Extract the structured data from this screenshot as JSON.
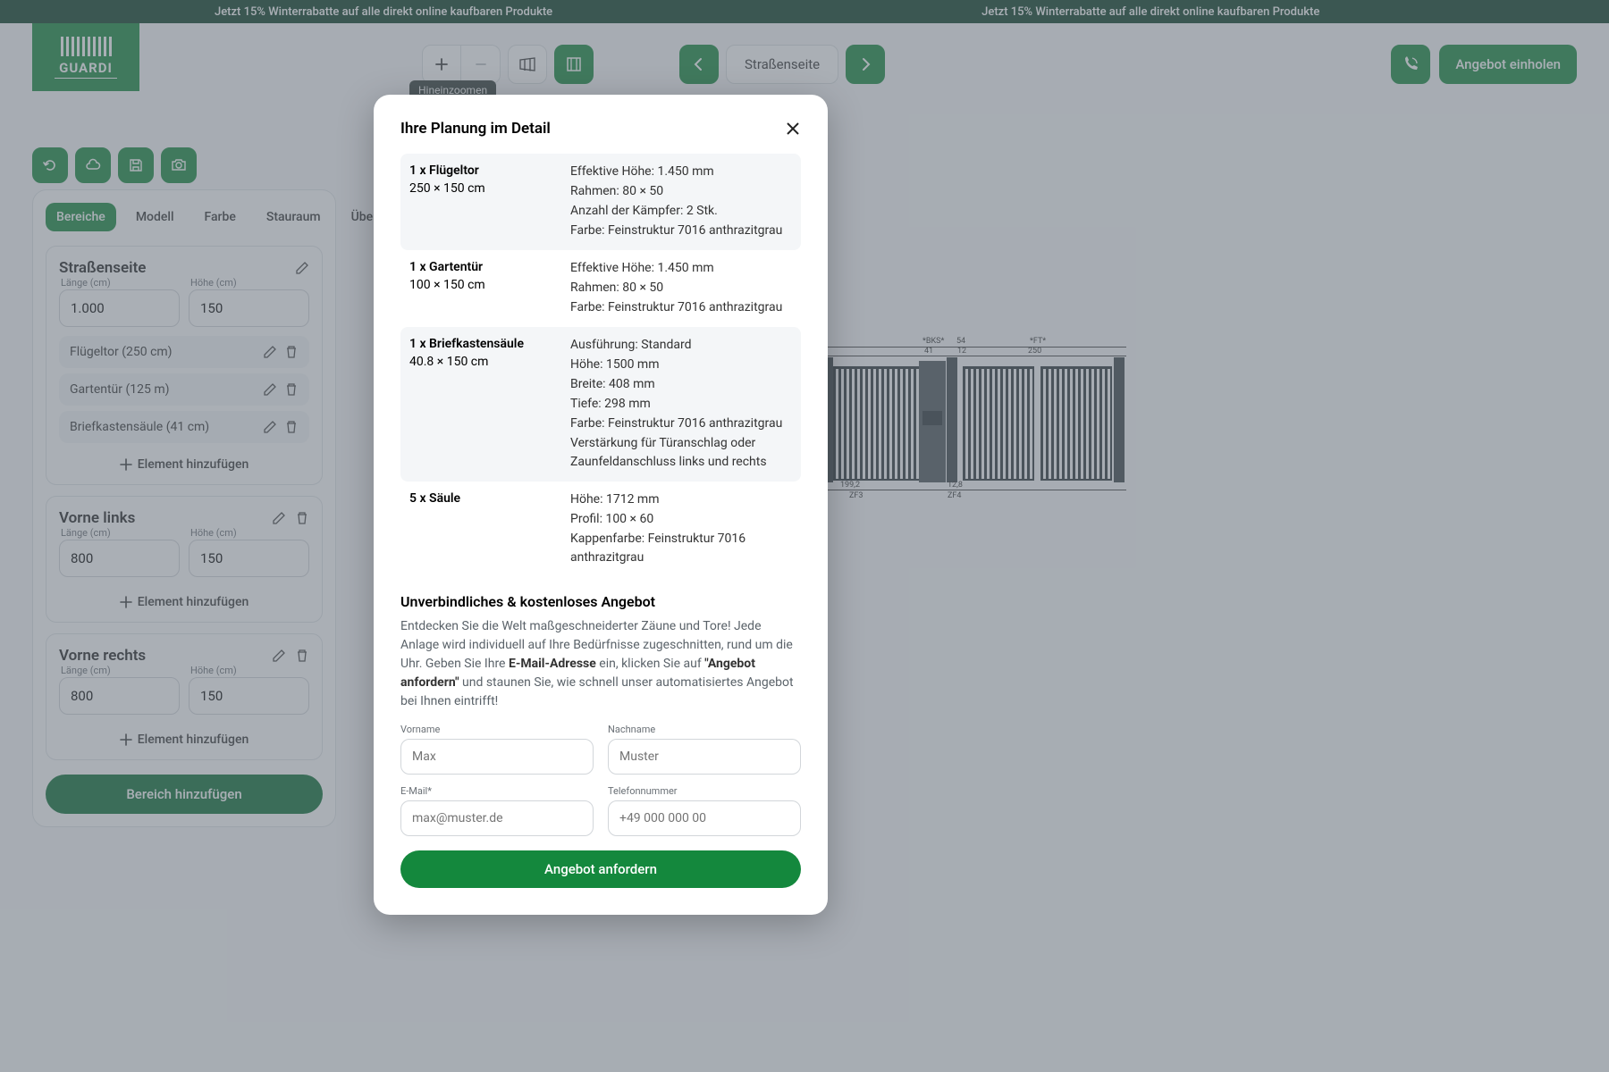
{
  "colors": {
    "brand": "#14883d",
    "brand_dark": "#0b3d25",
    "accent": "#0b6e34"
  },
  "banner": "Jetzt 15% Winterrabatte auf alle direkt online kaufbaren Produkte",
  "logo": "GUARDI",
  "top": {
    "tooltip": "Hineinzoomen",
    "view_label": "Straßenseite",
    "cta": "Angebot einholen"
  },
  "tabs": [
    "Bereiche",
    "Modell",
    "Farbe",
    "Stauraum",
    "Übersicht"
  ],
  "active_tab": "Bereiche",
  "labels": {
    "laenge": "Länge (cm)",
    "hoehe": "Höhe (cm)",
    "add_element": "Element hinzufügen",
    "add_region": "Bereich hinzufügen"
  },
  "regions": [
    {
      "title": "Straßenseite",
      "laenge": "1.000",
      "hoehe": "150",
      "deletable": false,
      "elements": [
        {
          "text": "Flügeltor (250 cm)"
        },
        {
          "text": "Gartentür (125 m)"
        },
        {
          "text": "Briefkastensäule (41 cm)"
        }
      ]
    },
    {
      "title": "Vorne links",
      "laenge": "800",
      "hoehe": "150",
      "deletable": true,
      "elements": []
    },
    {
      "title": "Vorne rechts",
      "laenge": "800",
      "hoehe": "150",
      "deletable": true,
      "elements": []
    }
  ],
  "preview": {
    "labels": {
      "bks": "*BKS*",
      "l_54": "54",
      "l_41": "41",
      "l_12": "12",
      "ft": "*FT*",
      "l_250": "250",
      "l_1992": "199,2",
      "zf3": "ZF3",
      "l_128": "12,8",
      "zf4": "ZF4"
    }
  },
  "modal": {
    "title": "Ihre Planung im Detail",
    "items": [
      {
        "title": "1 x Flügeltor",
        "dim": "250 × 150 cm",
        "specs": [
          "Effektive Höhe: 1.450 mm",
          "Rahmen: 80 × 50",
          "Anzahl der Kämpfer: 2 Stk.",
          "Farbe: Feinstruktur 7016 anthrazitgrau"
        ]
      },
      {
        "title": "1 x Gartentür",
        "dim": "100 × 150 cm",
        "specs": [
          "Effektive Höhe: 1.450 mm",
          "Rahmen: 80 × 50",
          "Farbe: Feinstruktur 7016 anthrazitgrau"
        ]
      },
      {
        "title": "1 x Briefkastensäule",
        "dim": "40.8 × 150 cm",
        "specs": [
          "Ausführung: Standard",
          "Höhe: 1500 mm",
          "Breite: 408 mm",
          "Tiefe: 298 mm",
          "Farbe: Feinstruktur 7016 anthrazitgrau",
          "Verstärkung für Türanschlag oder Zaunfeldanschluss links und rechts"
        ]
      },
      {
        "title": "5 x Säule",
        "dim": "",
        "specs": [
          "Höhe: 1712 mm",
          "Profil: 100 × 60",
          "Kappenfarbe: Feinstruktur 7016 anthrazitgrau"
        ]
      }
    ],
    "offer_title": "Unverbindliches & kostenloses Angebot",
    "offer_text_pre": "Entdecken Sie die Welt maßgeschneiderter Zäune und Tore! Jede Anlage wird individuell auf Ihre Bedürfnisse zugeschnitten, rund um die Uhr. Geben Sie Ihre ",
    "offer_bold1": "E-Mail-Adresse",
    "offer_text_mid": " ein, klicken Sie auf ",
    "offer_bold2": "\"Angebot anfordern\"",
    "offer_text_post": " und staunen Sie, wie schnell unser automatisiertes Angebot bei Ihnen eintrifft!",
    "form": {
      "vorname": {
        "label": "Vorname",
        "placeholder": "Max"
      },
      "nachname": {
        "label": "Nachname",
        "placeholder": "Muster"
      },
      "email": {
        "label": "E-Mail*",
        "placeholder": "max@muster.de"
      },
      "tel": {
        "label": "Telefonnummer",
        "placeholder": "+49 000 000 00"
      }
    },
    "submit": "Angebot anfordern"
  }
}
